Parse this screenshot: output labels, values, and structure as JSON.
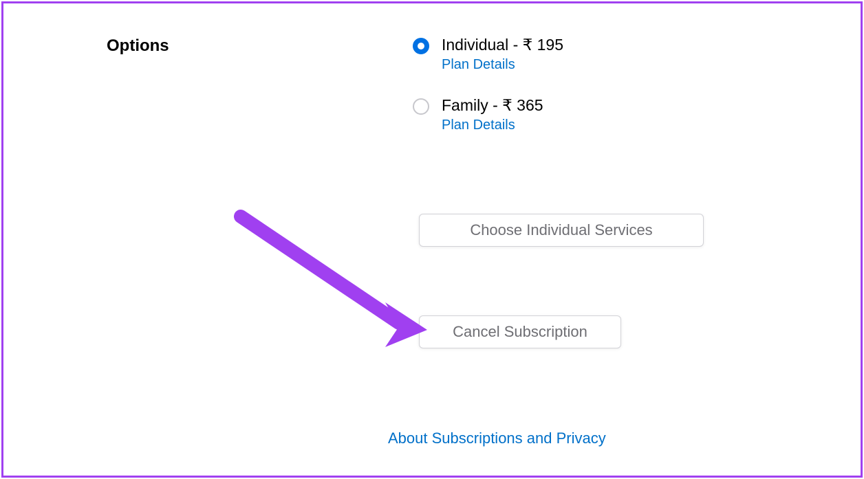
{
  "section": {
    "title": "Options"
  },
  "plans": [
    {
      "label": "Individual - ₹ 195",
      "details_link": "Plan Details",
      "selected": true
    },
    {
      "label": "Family - ₹ 365",
      "details_link": "Plan Details",
      "selected": false
    }
  ],
  "buttons": {
    "choose_services": "Choose Individual Services",
    "cancel_subscription": "Cancel Subscription"
  },
  "footer": {
    "about_link": "About Subscriptions and Privacy"
  },
  "annotation": {
    "type": "arrow",
    "color": "#a040f0"
  }
}
